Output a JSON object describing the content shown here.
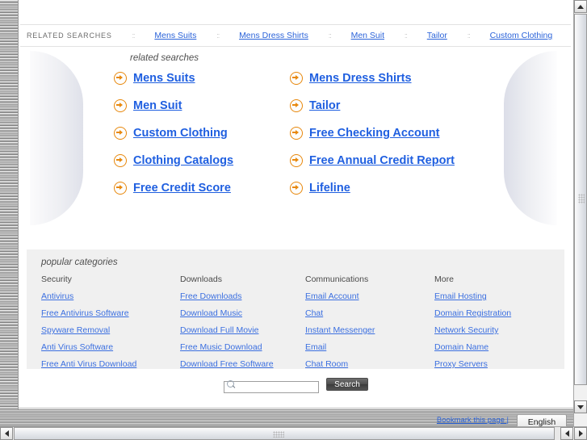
{
  "topbar": {
    "label": "RELATED SEARCHES",
    "separator": "::",
    "links": [
      "Mens Suits",
      "Mens Dress Shirts",
      "Men Suit",
      "Tailor",
      "Custom Clothing"
    ]
  },
  "related_searches": {
    "caption": "related searches",
    "items": [
      "Mens Suits",
      "Mens Dress Shirts",
      "Men Suit",
      "Tailor",
      "Custom Clothing",
      "Free Checking Account",
      "Clothing Catalogs",
      "Free Annual Credit Report",
      "Free Credit Score",
      "Lifeline"
    ]
  },
  "popular_categories": {
    "caption": "popular categories",
    "columns": [
      {
        "heading": "Security",
        "links": [
          "Antivirus",
          "Free Antivirus Software",
          "Spyware Removal",
          "Anti Virus Software",
          "Free Anti Virus Download"
        ]
      },
      {
        "heading": "Downloads",
        "links": [
          "Free Downloads",
          "Download Music",
          "Download Full Movie",
          "Free Music Download",
          "Download Free Software"
        ]
      },
      {
        "heading": "Communications",
        "links": [
          "Email Account",
          "Chat",
          "Instant Messenger",
          "Email",
          "Chat Room"
        ]
      },
      {
        "heading": "More",
        "links": [
          "Email Hosting",
          "Domain Registration",
          "Network Security",
          "Domain Name",
          "Proxy Servers"
        ]
      }
    ]
  },
  "search": {
    "value": "",
    "placeholder": "",
    "button_label": "Search",
    "icon": "magnifier-icon"
  },
  "statusbar": {
    "bookmark_label": "Bookmark this page |",
    "language": "English"
  },
  "colors": {
    "link_blue": "#2b63d9",
    "heading_link_blue": "#1f5fe0",
    "arrow_orange": "#e8880c",
    "panel_gray": "#f0f0f0"
  },
  "icons": {
    "arrow_bullet": "arrow-circle-right-icon",
    "scroll_up": "triangle-up-icon",
    "scroll_down": "triangle-down-icon",
    "scroll_left": "triangle-left-icon",
    "scroll_right": "triangle-right-icon"
  }
}
